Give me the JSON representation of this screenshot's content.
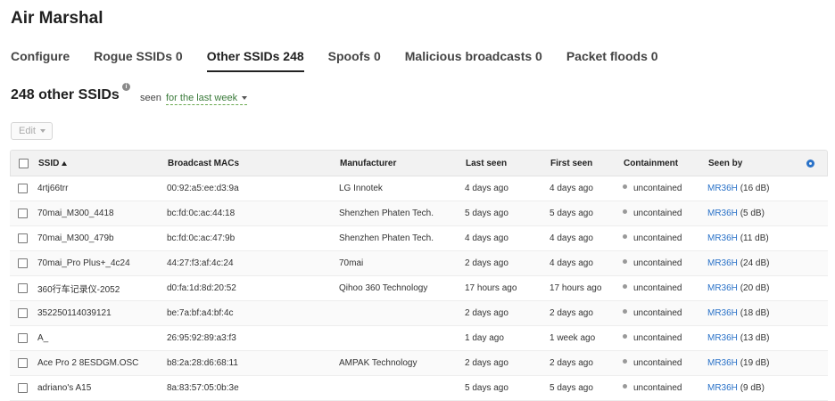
{
  "app": {
    "title": "Air Marshal"
  },
  "tabs": [
    {
      "label": "Configure"
    },
    {
      "label": "Rogue SSIDs 0"
    },
    {
      "label": "Other SSIDs 248"
    },
    {
      "label": "Spoofs 0"
    },
    {
      "label": "Malicious broadcasts 0"
    },
    {
      "label": "Packet floods 0"
    }
  ],
  "section": {
    "title": "248 other SSIDs",
    "info_icon": "info-icon",
    "seen_label": "seen",
    "seen_filter": "for the last week"
  },
  "toolbar": {
    "edit_label": "Edit"
  },
  "table": {
    "headers": {
      "ssid": "SSID",
      "mac": "Broadcast MACs",
      "manufacturer": "Manufacturer",
      "last_seen": "Last seen",
      "first_seen": "First seen",
      "containment": "Containment",
      "seen_by": "Seen by"
    },
    "sort": {
      "column": "ssid",
      "direction": "ascending"
    },
    "rows": [
      {
        "ssid": "4rtj66trr",
        "mac": "00:92:a5:ee:d3:9a",
        "manufacturer": "LG Innotek",
        "last_seen": "4 days ago",
        "first_seen": "4 days ago",
        "containment": "uncontained",
        "seen_by_ap": "MR36H",
        "seen_by_db": "(16 dB)"
      },
      {
        "ssid": "70mai_M300_4418",
        "mac": "bc:fd:0c:ac:44:18",
        "manufacturer": "Shenzhen Phaten Tech.",
        "last_seen": "5 days ago",
        "first_seen": "5 days ago",
        "containment": "uncontained",
        "seen_by_ap": "MR36H",
        "seen_by_db": "(5 dB)"
      },
      {
        "ssid": "70mai_M300_479b",
        "mac": "bc:fd:0c:ac:47:9b",
        "manufacturer": "Shenzhen Phaten Tech.",
        "last_seen": "4 days ago",
        "first_seen": "4 days ago",
        "containment": "uncontained",
        "seen_by_ap": "MR36H",
        "seen_by_db": "(11 dB)"
      },
      {
        "ssid": "70mai_Pro Plus+_4c24",
        "mac": "44:27:f3:af:4c:24",
        "manufacturer": "70mai",
        "last_seen": "2 days ago",
        "first_seen": "4 days ago",
        "containment": "uncontained",
        "seen_by_ap": "MR36H",
        "seen_by_db": "(24 dB)"
      },
      {
        "ssid": "360行车记录仪-2052",
        "mac": "d0:fa:1d:8d:20:52",
        "manufacturer": "Qihoo 360 Technology",
        "last_seen": "17 hours ago",
        "first_seen": "17 hours ago",
        "containment": "uncontained",
        "seen_by_ap": "MR36H",
        "seen_by_db": "(20 dB)"
      },
      {
        "ssid": "352250114039121",
        "mac": "be:7a:bf:a4:bf:4c",
        "manufacturer": "",
        "last_seen": "2 days ago",
        "first_seen": "2 days ago",
        "containment": "uncontained",
        "seen_by_ap": "MR36H",
        "seen_by_db": "(18 dB)"
      },
      {
        "ssid": "A_",
        "mac": "26:95:92:89:a3:f3",
        "manufacturer": "",
        "last_seen": "1 day ago",
        "first_seen": "1 week ago",
        "containment": "uncontained",
        "seen_by_ap": "MR36H",
        "seen_by_db": "(13 dB)"
      },
      {
        "ssid": "Ace Pro 2 8ESDGM.OSC",
        "mac": "b8:2a:28:d6:68:11",
        "manufacturer": "AMPAK Technology",
        "last_seen": "2 days ago",
        "first_seen": "2 days ago",
        "containment": "uncontained",
        "seen_by_ap": "MR36H",
        "seen_by_db": "(19 dB)"
      },
      {
        "ssid": "adriano's A15",
        "mac": "8a:83:57:05:0b:3e",
        "manufacturer": "",
        "last_seen": "5 days ago",
        "first_seen": "5 days ago",
        "containment": "uncontained",
        "seen_by_ap": "MR36H",
        "seen_by_db": "(9 dB)"
      }
    ]
  },
  "icons": {
    "settings": "gear-icon",
    "containment": "status-dot-icon"
  },
  "colors": {
    "link": "#2a72c8",
    "filter": "#3a7a3a",
    "status_dot": "#999999"
  }
}
